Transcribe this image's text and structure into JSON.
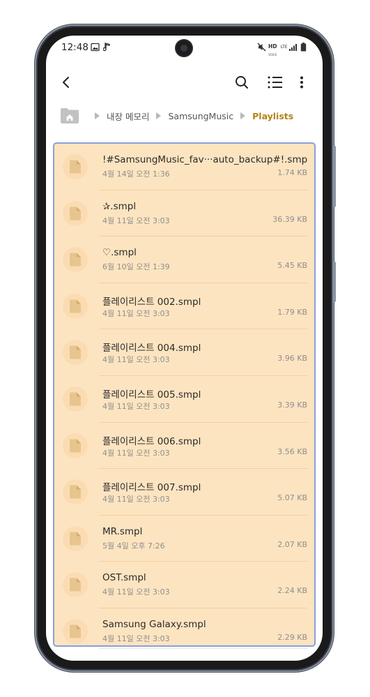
{
  "status_bar": {
    "time": "12:48",
    "network_hd": "HD",
    "network_lte": "LTE",
    "network_voice": "VOICE"
  },
  "app_bar": {
    "back_icon": "arrow-back-icon",
    "search_icon": "search-icon",
    "list_view_icon": "list-view-icon",
    "more_icon": "more-vert-icon"
  },
  "breadcrumb": {
    "items": [
      "내장 메모리",
      "SamsungMusic",
      "Playlists"
    ]
  },
  "colors": {
    "accent": "#b38416",
    "list_background": "#fde4c0",
    "list_border": "#8aa0da",
    "file_icon": "#e6c58f"
  },
  "files": [
    {
      "name": "!#SamsungMusic_fav···auto_backup#!.smpl",
      "date": "4월 14일 오전 1:36",
      "size": "1.74 KB"
    },
    {
      "name": "✰.smpl",
      "date": "4월 11일 오전 3:03",
      "size": "36.39 KB"
    },
    {
      "name": "♡.smpl",
      "date": "6월 10일 오전 1:39",
      "size": "5.45 KB"
    },
    {
      "name": "플레이리스트 002.smpl",
      "date": "4월 11일 오전 3:03",
      "size": "1.79 KB"
    },
    {
      "name": "플레이리스트 004.smpl",
      "date": "4월 11일 오전 3:03",
      "size": "3.96 KB"
    },
    {
      "name": "플레이리스트 005.smpl",
      "date": "4월 11일 오전 3:03",
      "size": "3.39 KB"
    },
    {
      "name": "플레이리스트 006.smpl",
      "date": "4월 11일 오전 3:03",
      "size": "3.56 KB"
    },
    {
      "name": "플레이리스트 007.smpl",
      "date": "4월 11일 오전 3:03",
      "size": "5.07 KB"
    },
    {
      "name": "MR.smpl",
      "date": "5월 4일 오후 7:26",
      "size": "2.07 KB"
    },
    {
      "name": "OST.smpl",
      "date": "4월 11일 오전 3:03",
      "size": "2.24 KB"
    },
    {
      "name": "Samsung Galaxy.smpl",
      "date": "4월 11일 오전 3:03",
      "size": "2.29 KB"
    }
  ]
}
